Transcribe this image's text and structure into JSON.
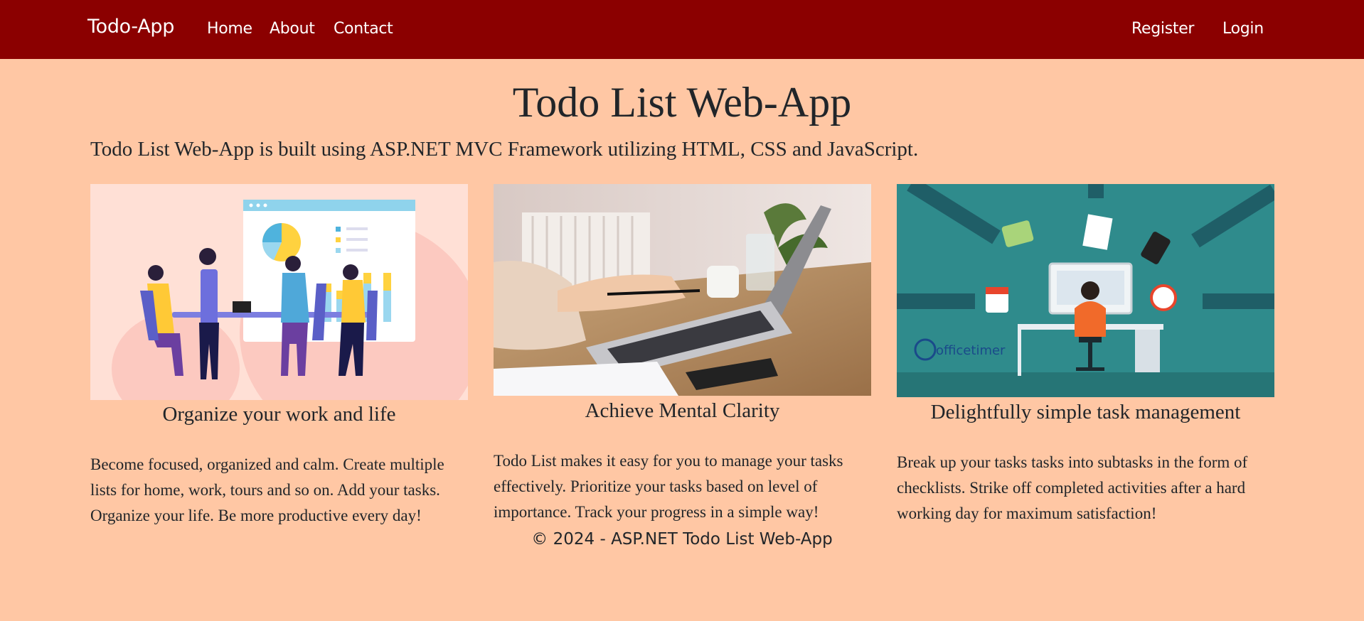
{
  "navbar": {
    "brand": "Todo-App",
    "links": [
      "Home",
      "About",
      "Contact"
    ],
    "register": "Register",
    "login": "Login",
    "bg_color": "#8b0000"
  },
  "main": {
    "title": "Todo List Web-App",
    "lead": "Todo List Web-App is built using ASP.NET MVC Framework utilizing HTML, CSS and JavaScript.",
    "bg_color": "#ffc7a4",
    "cards": [
      {
        "image": "team-meeting-illustration",
        "heading": "Organize your work and life",
        "text": "Become focused, organized and calm. Create multiple lists for home, work, tours and so on. Add your tasks. Organize your life. Be more productive every day!"
      },
      {
        "image": "laptop-typing-photo",
        "heading": "Achieve Mental Clarity",
        "text": "Todo List makes it easy for you to manage your tasks effectively. Prioritize your tasks based on level of importance. Track your progress in a simple way!"
      },
      {
        "image": "task-management-illustration",
        "heading": "Delightfully simple task management",
        "text": "Break up your tasks tasks into subtasks in the form of checklists. Strike off completed activities after a hard working day for maximum satisfaction!",
        "logo_text": "officetimer"
      }
    ]
  },
  "footer": {
    "text": "© 2024 - ASP.NET Todo List Web-App"
  }
}
